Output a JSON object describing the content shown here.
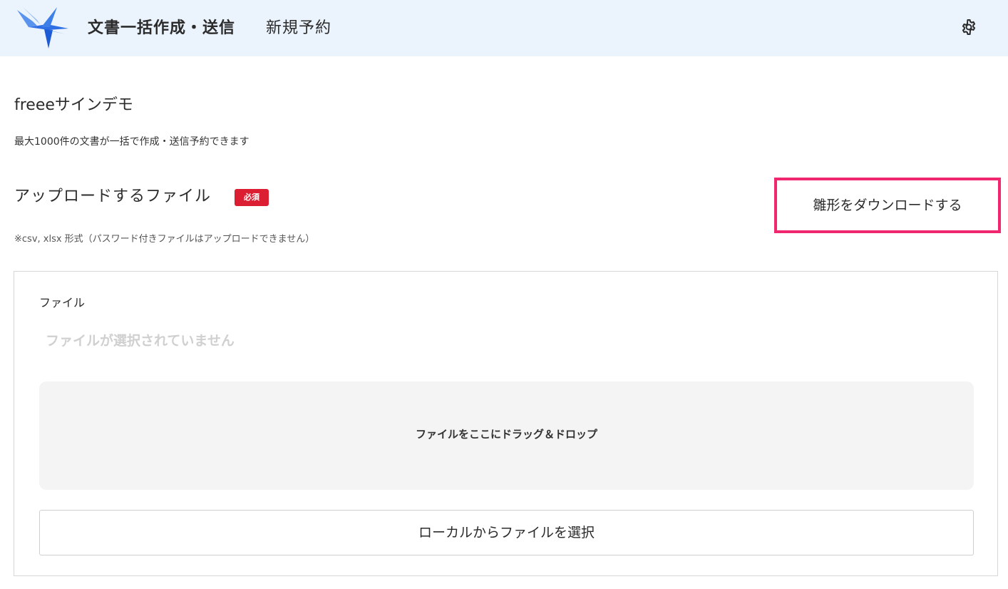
{
  "header": {
    "title": "文書一括作成・送信",
    "subtitle": "新規予約",
    "settings_icon": "gear-icon"
  },
  "colors": {
    "header_bg": "#ebf3fd",
    "required_badge": "#dc1e32",
    "highlight": "#f0266e",
    "logo_blue": "#2f6fe4"
  },
  "account": {
    "name": "freeeサインデモ"
  },
  "intro": {
    "description": "最大1000件の文書が一括で作成・送信予約できます"
  },
  "upload": {
    "section_title": "アップロードするファイル",
    "required_label": "必須",
    "note": "※csv, xlsx 形式（パスワード付きファイルはアップロードできません）",
    "template_download_label": "雛形をダウンロードする",
    "file_label": "ファイル",
    "no_file_text": "ファイルが選択されていません",
    "dropzone_text": "ファイルをここにドラッグ＆ドロップ",
    "select_local_label": "ローカルからファイルを選択"
  }
}
